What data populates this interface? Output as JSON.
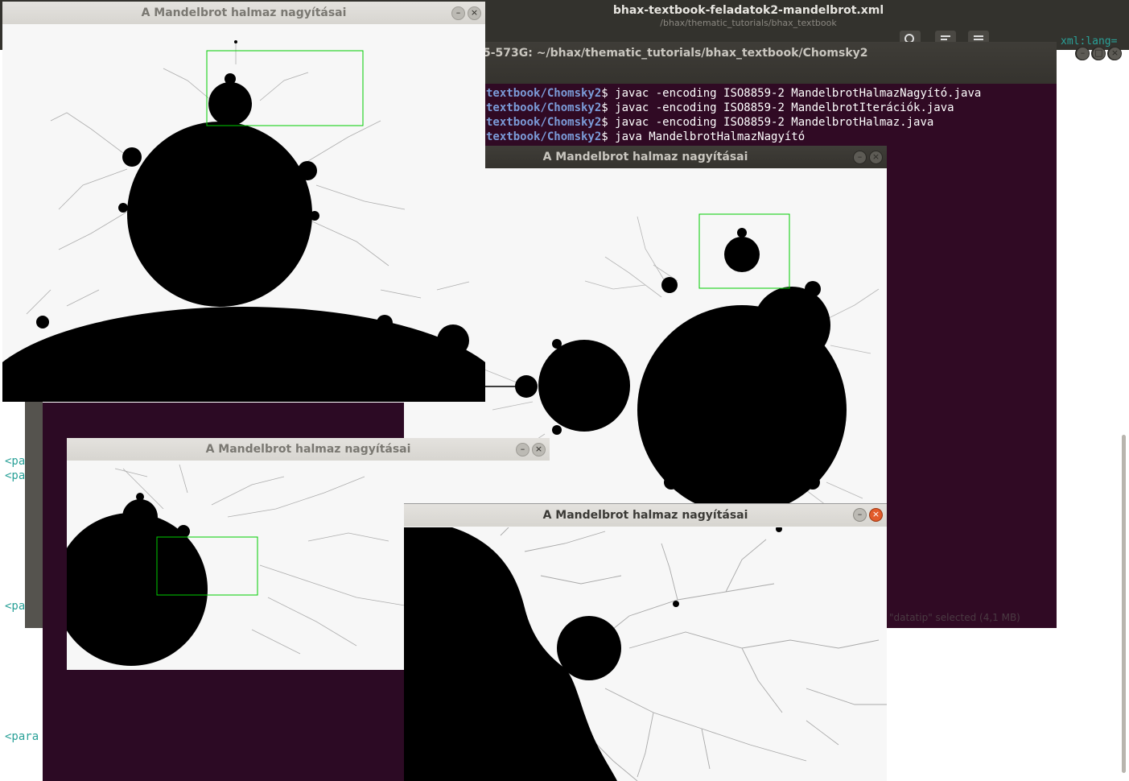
{
  "editor": {
    "title": "bhax-textbook-feladatok2-mandelbrot.xml",
    "subtitle": "/bhax/thematic_tutorials/bhax_textbook",
    "tag_lines": [
      "<pa",
      "<pa",
      "<pa",
      "<para"
    ],
    "corner_code": "xml:lang=",
    "status_text": "\"datatip\" selected (4,1 MB)"
  },
  "terminal": {
    "title": "5-573G: ~/bhax/thematic_tutorials/bhax_textbook/Chomsky2",
    "lines": [
      {
        "path": "textbook/Chomsky2",
        "cmd": "$ javac -encoding ISO8859-2 MandelbrotHalmazNagyító.java"
      },
      {
        "path": "textbook/Chomsky2",
        "cmd": "$ javac -encoding ISO8859-2 MandelbrotIterációk.java"
      },
      {
        "path": "textbook/Chomsky2",
        "cmd": "$ javac -encoding ISO8859-2 MandelbrotHalmaz.java"
      },
      {
        "path": "textbook/Chomsky2",
        "cmd": "$ java MandelbrotHalmazNagyító"
      }
    ]
  },
  "windows": [
    {
      "title": "A Mandelbrot halmaz nagyításai"
    },
    {
      "title": "A Mandelbrot halmaz nagyításai"
    },
    {
      "title": "A Mandelbrot halmaz nagyításai"
    },
    {
      "title": "A Mandelbrot halmaz nagyításai"
    }
  ],
  "colors": {
    "terminal_bg": "#300a24",
    "selection": "#00cc00",
    "close_button": "#e25b2b"
  }
}
